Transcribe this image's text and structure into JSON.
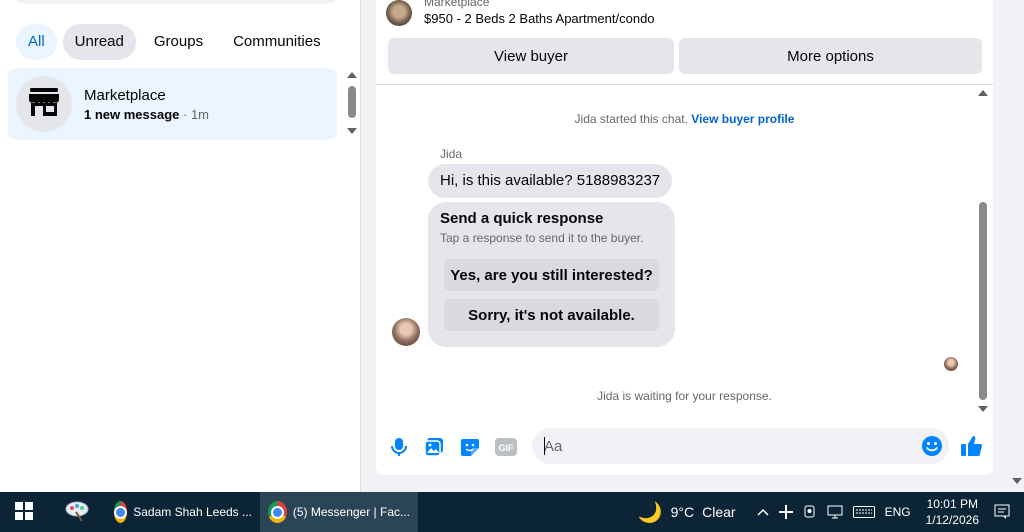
{
  "filters": [
    {
      "label": "All",
      "active": true
    },
    {
      "label": "Unread",
      "active": false
    },
    {
      "label": "Groups",
      "active": false
    },
    {
      "label": "Communities",
      "active": false
    }
  ],
  "conversation": {
    "title": "Marketplace",
    "new_label": "1 new message",
    "separator": " · ",
    "time": "1m",
    "icon": "shop-icon"
  },
  "listing": {
    "category": "Marketplace",
    "title": "$950 - 2 Beds 2 Baths Apartment/condo"
  },
  "actions": {
    "view_buyer": "View buyer",
    "more_options": "More options"
  },
  "chat": {
    "started_text": "Jida started this chat.",
    "view_profile": "View buyer profile",
    "sender": "Jida",
    "message": "Hi, is this available? 5188983237",
    "quick": {
      "title": "Send a quick response",
      "subtitle": "Tap a response to send it to the buyer.",
      "option1": "Yes, are you still interested?",
      "option2": "Sorry, it's not available."
    },
    "waiting": "Jida is waiting for your response."
  },
  "composer": {
    "placeholder": "Aa",
    "icons": [
      "microphone-icon",
      "photo-icon",
      "sticker-icon",
      "gif-icon",
      "emoji-icon",
      "like-icon"
    ]
  },
  "taskbar": {
    "app1": "Sadam Shah Leeds ...",
    "app2": "(5) Messenger | Fac...",
    "weather_temp": "9°C",
    "weather_text": "Clear",
    "lang": "ENG",
    "time": "10:01 PM",
    "date": "1/12/2026"
  },
  "colors": {
    "accent": "#0084ff",
    "active_chip_bg": "#ebf5ff",
    "bubble_bg": "#e4e6eb",
    "taskbar_bg": "#0b2536"
  }
}
